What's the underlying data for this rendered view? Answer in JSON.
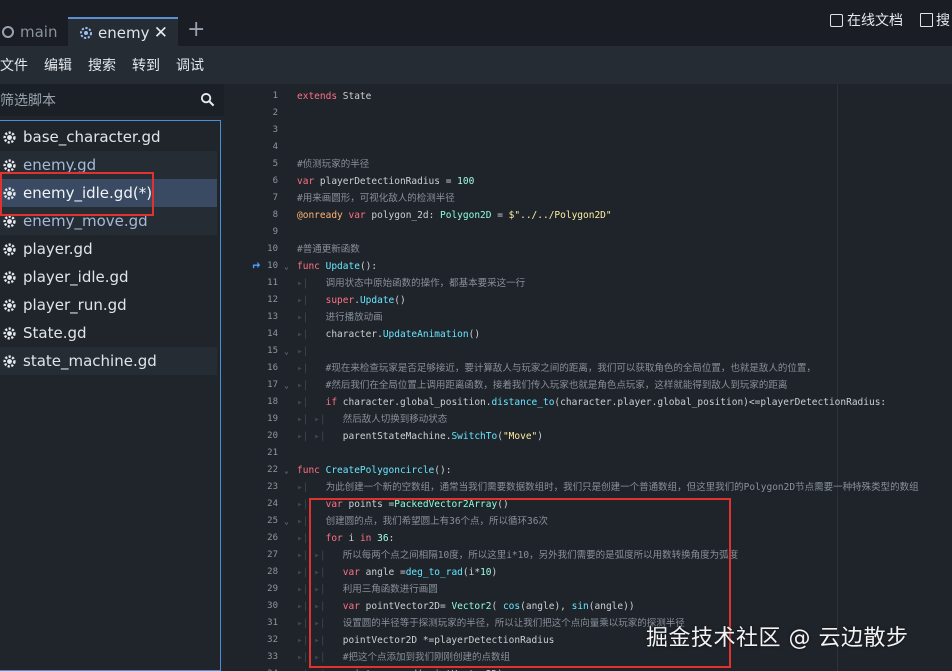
{
  "tabs": [
    {
      "label": "main",
      "icon": "circle-icon"
    },
    {
      "label": "enemy",
      "icon": "gear-icon",
      "active": true
    }
  ],
  "menu": {
    "items": [
      "文件",
      "编辑",
      "搜索",
      "转到",
      "调试"
    ],
    "online_docs": "在线文档",
    "search_help": "搜"
  },
  "sidebar": {
    "filter_placeholder": "筛选脚本",
    "files": [
      {
        "name": "base_character.gd"
      },
      {
        "name": "enemy.gd"
      },
      {
        "name": "enemy_idle.gd(*)"
      },
      {
        "name": "enemy_move.gd"
      },
      {
        "name": "player.gd"
      },
      {
        "name": "player_idle.gd"
      },
      {
        "name": "player_run.gd"
      },
      {
        "name": "State.gd"
      },
      {
        "name": "state_machine.gd"
      }
    ]
  },
  "editor": {
    "lines": [
      {
        "n": "1",
        "parts": [
          [
            "kw",
            "extends "
          ],
          [
            "tx",
            "State"
          ]
        ]
      },
      {
        "n": "2",
        "parts": []
      },
      {
        "n": "3",
        "parts": []
      },
      {
        "n": "4",
        "parts": []
      },
      {
        "n": "5",
        "parts": [
          [
            "cm",
            "#侦测玩家的半径"
          ]
        ]
      },
      {
        "n": "6",
        "parts": [
          [
            "kw",
            "var "
          ],
          [
            "tx",
            "playerDetectionRadius = "
          ],
          [
            "num",
            "100"
          ]
        ]
      },
      {
        "n": "7",
        "parts": [
          [
            "cm",
            "#用来画圆形，可视化敌人的检测半径"
          ]
        ]
      },
      {
        "n": "8",
        "parts": [
          [
            "an",
            "@onready "
          ],
          [
            "kw",
            "var "
          ],
          [
            "tx",
            "polygon_2d: "
          ],
          [
            "ty",
            "Polygon2D"
          ],
          [
            "tx",
            " = "
          ],
          [
            "str",
            "$\"../../Polygon2D\""
          ]
        ]
      },
      {
        "n": "9",
        "parts": []
      },
      {
        "n": "10",
        "parts": [
          [
            "cm",
            "#普通更新函数"
          ]
        ]
      },
      {
        "n": "10",
        "parts": [
          [
            "kw",
            "func "
          ],
          [
            "fn",
            "Update"
          ],
          [
            "tx",
            "():"
          ]
        ]
      },
      {
        "n": "11",
        "parts": [
          [
            "guide",
            "▸| "
          ],
          [
            "cm",
            "  调用状态中原始函数的操作，都基本要采这一行"
          ]
        ]
      },
      {
        "n": "12",
        "parts": [
          [
            "guide",
            "▸|   "
          ],
          [
            "kw",
            "super"
          ],
          [
            "tx",
            "."
          ],
          [
            "fn",
            "Update"
          ],
          [
            "tx",
            "()"
          ]
        ]
      },
      {
        "n": "13",
        "parts": [
          [
            "guide",
            "▸| "
          ],
          [
            "cm",
            "  进行播放动画"
          ]
        ]
      },
      {
        "n": "14",
        "parts": [
          [
            "guide",
            "▸|   "
          ],
          [
            "tx",
            "character."
          ],
          [
            "fn",
            "UpdateAnimation"
          ],
          [
            "tx",
            "()"
          ]
        ]
      },
      {
        "n": "15",
        "parts": [
          [
            "guide",
            "▸|"
          ]
        ]
      },
      {
        "n": "16",
        "parts": [
          [
            "guide",
            "▸|   "
          ],
          [
            "cm",
            "#现在来检查玩家是否足够接近，要计算敌人与玩家之间的距离，我们可以获取角色的全局位置，也就是敌人的位置，"
          ]
        ]
      },
      {
        "n": "17",
        "parts": [
          [
            "guide",
            "▸|   "
          ],
          [
            "cm",
            "#然后我们在全局位置上调用距离函数，接着我们传入玩家也就是角色点玩家，这样就能得到敌人到玩家的距离"
          ]
        ]
      },
      {
        "n": "18",
        "parts": [
          [
            "guide",
            "▸|   "
          ],
          [
            "kw",
            "if "
          ],
          [
            "tx",
            "character.global_position."
          ],
          [
            "fn",
            "distance_to"
          ],
          [
            "tx",
            "(character.player.global_position)<=playerDetectionRadius:"
          ]
        ]
      },
      {
        "n": "19",
        "parts": [
          [
            "guide",
            "▸| ▸| "
          ],
          [
            "cm",
            "  然后敌人切换到移动状态"
          ]
        ]
      },
      {
        "n": "20",
        "parts": [
          [
            "guide",
            "▸| ▸|   "
          ],
          [
            "tx",
            "parentStateMachine."
          ],
          [
            "fn",
            "SwitchTo"
          ],
          [
            "tx",
            "("
          ],
          [
            "str",
            "\"Move\""
          ],
          [
            "tx",
            ")"
          ]
        ]
      },
      {
        "n": "21",
        "parts": []
      },
      {
        "n": "22",
        "parts": [
          [
            "kw",
            "func "
          ],
          [
            "fn",
            "CreatePolygoncircle"
          ],
          [
            "tx",
            "():"
          ]
        ]
      },
      {
        "n": "23",
        "parts": [
          [
            "guide",
            "▸| "
          ],
          [
            "cm",
            "  为此创建一个新的空数组，通常当我们需要数据数组时，我们只是创建一个普通数组，但这里我们的Polygon2D节点需要一种特殊类型的数组"
          ]
        ]
      },
      {
        "n": "24",
        "parts": [
          [
            "guide",
            "▸|   "
          ],
          [
            "kw",
            "var "
          ],
          [
            "tx",
            "points ="
          ],
          [
            "ty",
            "PackedVector2Array"
          ],
          [
            "tx",
            "()"
          ]
        ]
      },
      {
        "n": "25",
        "parts": [
          [
            "guide",
            "▸| "
          ],
          [
            "cm",
            "  创建圆的点，我们希望圆上有36个点，所以循环36次"
          ]
        ]
      },
      {
        "n": "26",
        "parts": [
          [
            "guide",
            "▸|   "
          ],
          [
            "kw",
            "for "
          ],
          [
            "tx",
            "i "
          ],
          [
            "kw",
            "in "
          ],
          [
            "num",
            "36"
          ],
          [
            "tx",
            ":"
          ]
        ]
      },
      {
        "n": "27",
        "parts": [
          [
            "guide",
            "▸| ▸| "
          ],
          [
            "cm",
            "  所以每两个点之间相隔10度，所以这里i*10，另外我们需要的是弧度所以用数转换角度为弧度"
          ]
        ]
      },
      {
        "n": "28",
        "parts": [
          [
            "guide",
            "▸| ▸|   "
          ],
          [
            "kw",
            "var "
          ],
          [
            "tx",
            "angle ="
          ],
          [
            "fn",
            "deg_to_rad"
          ],
          [
            "tx",
            "(i*"
          ],
          [
            "num",
            "10"
          ],
          [
            "tx",
            ")"
          ]
        ]
      },
      {
        "n": "29",
        "parts": [
          [
            "guide",
            "▸| ▸| "
          ],
          [
            "cm",
            "  利用三角函数进行画圆"
          ]
        ]
      },
      {
        "n": "30",
        "parts": [
          [
            "guide",
            "▸| ▸|   "
          ],
          [
            "kw",
            "var "
          ],
          [
            "tx",
            "pointVector2D= "
          ],
          [
            "ty",
            "Vector2"
          ],
          [
            "tx",
            "( "
          ],
          [
            "fn",
            "cos"
          ],
          [
            "tx",
            "(angle), "
          ],
          [
            "fn",
            "sin"
          ],
          [
            "tx",
            "(angle))"
          ]
        ]
      },
      {
        "n": "31",
        "parts": [
          [
            "guide",
            "▸| ▸| "
          ],
          [
            "cm",
            "  设置圆的半径等于探测玩家的半径，所以让我们把这个点向量乘以玩家的探测半径"
          ]
        ]
      },
      {
        "n": "32",
        "parts": [
          [
            "guide",
            "▸| ▸|   "
          ],
          [
            "tx",
            "pointVector2D *=playerDetectionRadius"
          ]
        ]
      },
      {
        "n": "33",
        "parts": [
          [
            "guide",
            "▸| ▸|   "
          ],
          [
            "cm",
            "#把这个点添加到我们刚刚创建的点数组"
          ]
        ]
      },
      {
        "n": "34",
        "parts": [
          [
            "guide",
            "▸| ▸|   "
          ],
          [
            "tx",
            "points."
          ],
          [
            "fn",
            "append"
          ],
          [
            "tx",
            "(pointVector2D)"
          ]
        ]
      }
    ]
  },
  "watermark": "掘金技术社区 @ 云边散步",
  "colors": {
    "accent": "#4a8fd8",
    "highlight_box": "#e0322f",
    "selected_row": "#3a4a63"
  }
}
